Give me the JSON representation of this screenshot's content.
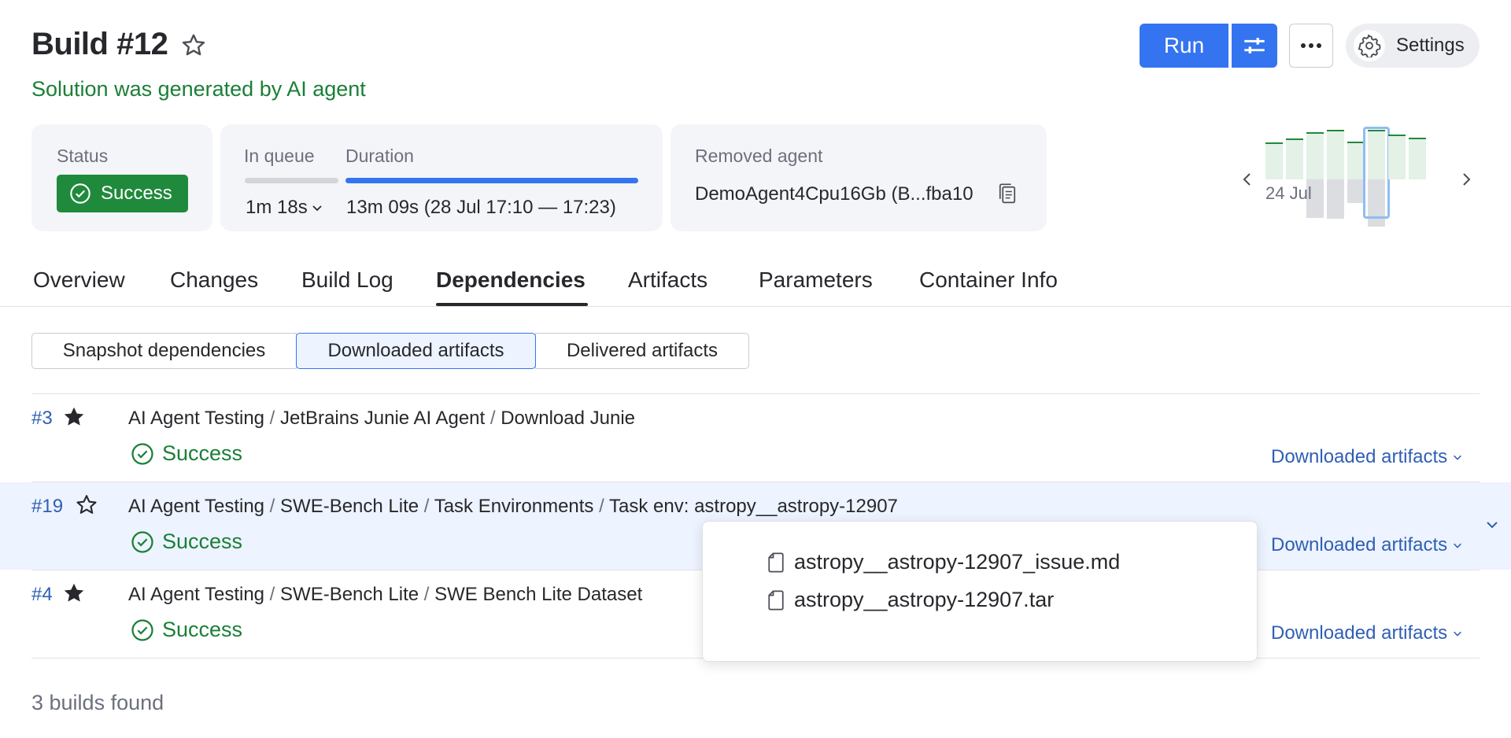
{
  "header": {
    "title": "Build #12",
    "subtitle": "Solution was generated by AI agent",
    "run_label": "Run",
    "settings_label": "Settings"
  },
  "info": {
    "status_label": "Status",
    "status_value": "Success",
    "queue_label": "In queue",
    "queue_value": "1m 18s",
    "duration_label": "Duration",
    "duration_value": "13m 09s (28 Jul 17:10 — 17:23)",
    "agent_label": "Removed agent",
    "agent_value": "DemoAgent4Cpu16Gb (B...fba10"
  },
  "history": {
    "date_label": "24 Jul"
  },
  "tabs": [
    {
      "label": "Overview"
    },
    {
      "label": "Changes"
    },
    {
      "label": "Build Log"
    },
    {
      "label": "Dependencies"
    },
    {
      "label": "Artifacts"
    },
    {
      "label": "Parameters"
    },
    {
      "label": "Container Info"
    }
  ],
  "segments": [
    {
      "label": "Snapshot dependencies"
    },
    {
      "label": "Downloaded artifacts"
    },
    {
      "label": "Delivered artifacts"
    }
  ],
  "builds": [
    {
      "number": "#3",
      "path": [
        "AI Agent Testing",
        "JetBrains Junie AI Agent",
        "Download Junie"
      ],
      "status": "Success",
      "link": "Downloaded artifacts"
    },
    {
      "number": "#19",
      "path": [
        "AI Agent Testing",
        "SWE-Bench Lite",
        "Task Environments",
        "Task env: astropy__astropy-12907"
      ],
      "status": "Success",
      "link": "Downloaded artifacts"
    },
    {
      "number": "#4",
      "path": [
        "AI Agent Testing",
        "SWE-Bench Lite",
        "SWE Bench Lite Dataset"
      ],
      "status": "Success",
      "link": "Downloaded artifacts"
    }
  ],
  "popup": {
    "files": [
      "astropy__astropy-12907_issue.md",
      "astropy__astropy-12907.tar"
    ]
  },
  "footer": "3 builds found",
  "colors": {
    "accent": "#3574f0",
    "success": "#208a3c",
    "link": "#2f5fb3"
  }
}
